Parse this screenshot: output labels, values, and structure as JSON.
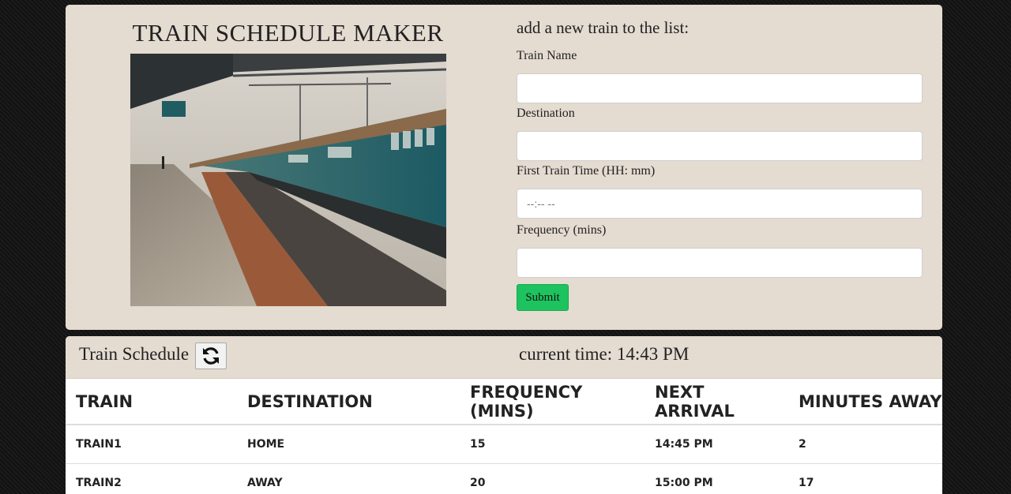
{
  "app": {
    "title": "TRAIN SCHEDULE MAKER"
  },
  "form": {
    "heading": "add a new train to the list:",
    "fields": [
      {
        "label": "Train Name",
        "value": "",
        "placeholder": ""
      },
      {
        "label": "Destination",
        "value": "",
        "placeholder": ""
      },
      {
        "label": "First Train Time (HH: mm)",
        "value": "",
        "placeholder": "--:-- --"
      },
      {
        "label": "Frequency (mins)",
        "value": "",
        "placeholder": ""
      }
    ],
    "submit_label": "Submit"
  },
  "schedule": {
    "title": "Train Schedule",
    "refresh_icon": "refresh-icon",
    "current_time": "current time: 14:43 PM",
    "columns": [
      "Train",
      "Destination",
      "Frequency (mins)",
      "Next Arrival",
      "Minutes Away"
    ],
    "rows": [
      [
        "Train1",
        "Home",
        "15",
        "14:45 PM",
        "2"
      ],
      [
        "Train2",
        "Away",
        "20",
        "15:00 PM",
        "17"
      ]
    ]
  },
  "colors": {
    "panel": "#e4dbd1",
    "submit": "#1dc35f",
    "background": "#161616"
  }
}
